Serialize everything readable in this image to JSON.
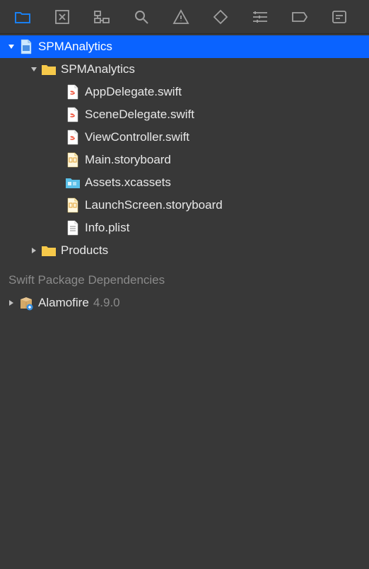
{
  "project": {
    "name": "SPMAnalytics",
    "rootFolder": "SPMAnalytics",
    "files": [
      "AppDelegate.swift",
      "SceneDelegate.swift",
      "ViewController.swift",
      "Main.storyboard",
      "Assets.xcassets",
      "LaunchScreen.storyboard",
      "Info.plist"
    ],
    "productsFolder": "Products"
  },
  "section": {
    "dependencies": "Swift Package Dependencies"
  },
  "dependencies": [
    {
      "name": "Alamofire",
      "version": "4.9.0"
    }
  ]
}
